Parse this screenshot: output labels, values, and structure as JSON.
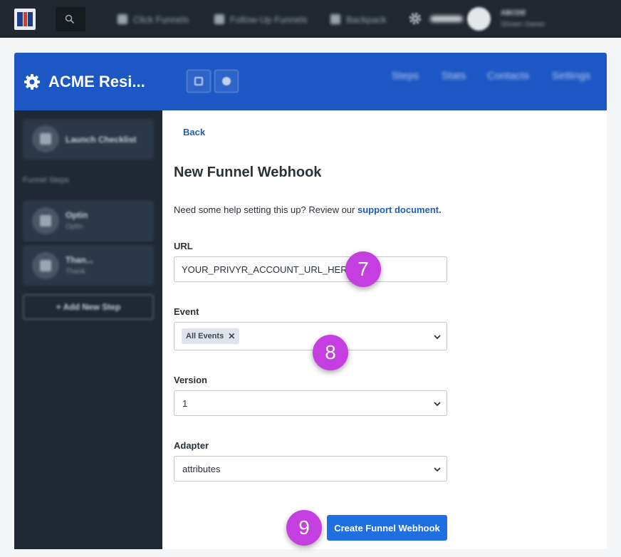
{
  "topbar": {
    "nav_items": [
      "Click Funnels",
      "Follow-Up Funnels",
      "Backpack"
    ],
    "user_name": "ABCDE",
    "user_role": "Shown Owner"
  },
  "funnel": {
    "title": "ACME Resi...",
    "nav_items": [
      "Steps",
      "Stats",
      "Contacts",
      "Settings"
    ]
  },
  "sidebar": {
    "launch_checklist": "Launch Checklist",
    "section_title": "Funnel Steps",
    "steps": [
      {
        "name": "Optin",
        "type": "Optin"
      },
      {
        "name": "Than...",
        "type": "Thank"
      }
    ],
    "add_new_step": "Add New Step"
  },
  "form": {
    "back_label": "Back",
    "title": "New Funnel Webhook",
    "help_text": "Need some help setting this up? Review our",
    "help_link": "support document.",
    "url_label": "URL",
    "url_value": "YOUR_PRIVYR_ACCOUNT_URL_HERE",
    "event_label": "Event",
    "event_tag": "All Events",
    "version_label": "Version",
    "version_value": "1",
    "adapter_label": "Adapter",
    "adapter_value": "attributes",
    "submit_label": "Create Funnel Webhook"
  },
  "markers": {
    "url": "7",
    "event": "8",
    "submit": "9"
  },
  "colors": {
    "accent": "#1d57c4",
    "button": "#1f6fe0",
    "marker": "#c43ee0",
    "link": "#1f5fb5"
  }
}
